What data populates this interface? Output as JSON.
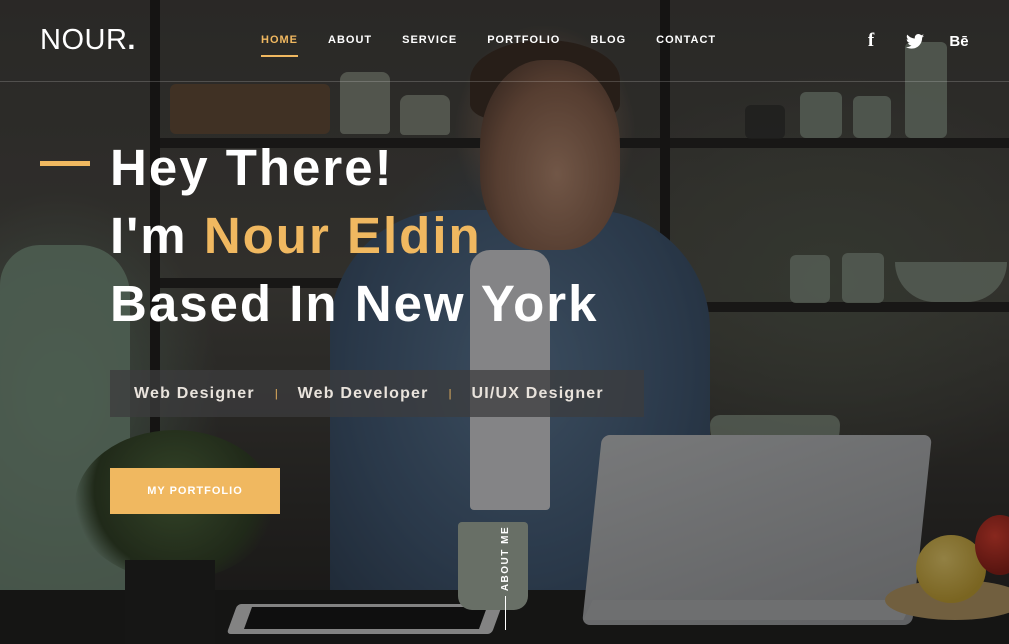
{
  "header": {
    "logo": "NOUR",
    "logo_dot": ".",
    "nav": [
      {
        "label": "HOME",
        "active": true
      },
      {
        "label": "ABOUT",
        "active": false
      },
      {
        "label": "SERVICE",
        "active": false
      },
      {
        "label": "PORTFOLIO",
        "active": false
      },
      {
        "label": "BLOG",
        "active": false
      },
      {
        "label": "CONTACT",
        "active": false
      }
    ],
    "social": [
      {
        "icon": "facebook-icon",
        "glyph": "f"
      },
      {
        "icon": "twitter-icon",
        "glyph": ""
      },
      {
        "icon": "behance-icon",
        "glyph": "Bē"
      }
    ]
  },
  "hero": {
    "line1": "Hey There!",
    "line2_prefix": "I'm ",
    "line2_name": "Nour Eldin",
    "line3": "Based In New York",
    "roles": [
      "Web Designer",
      "Web Developer",
      "UI/UX Designer"
    ],
    "role_separator": "|",
    "cta_label": "MY PORTFOLIO",
    "about_me_label": "ABOUT ME"
  },
  "colors": {
    "accent": "#f0b860",
    "text": "#ffffff",
    "roles_bg": "#3c3c3e"
  }
}
